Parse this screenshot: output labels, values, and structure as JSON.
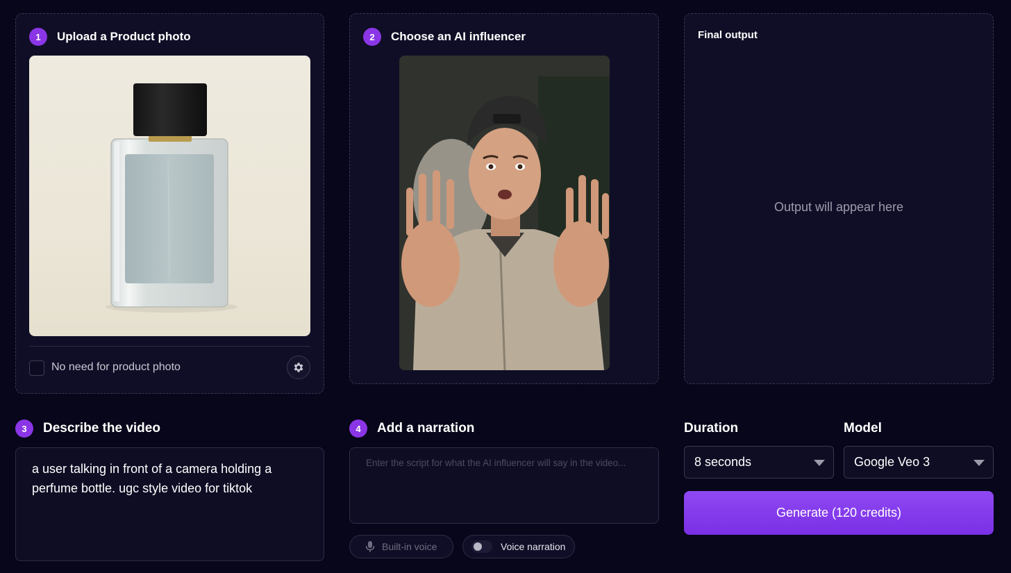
{
  "step1": {
    "number": "1",
    "title": "Upload a Product photo",
    "checkbox_label": "No need for product photo",
    "checked": false
  },
  "step2": {
    "number": "2",
    "title": "Choose an AI influencer"
  },
  "output": {
    "title": "Final output",
    "placeholder": "Output will appear here"
  },
  "step3": {
    "number": "3",
    "title": "Describe the video",
    "value": "a user talking in front of a camera holding a perfume bottle. ugc style video for tiktok"
  },
  "step4": {
    "number": "4",
    "title": "Add a narration",
    "placeholder": "Enter the script for what the AI influencer will say in the video...",
    "builtin_voice_label": "Built-in voice",
    "voice_narration_label": "Voice narration",
    "voice_narration_on": false
  },
  "duration": {
    "label": "Duration",
    "value": "8 seconds"
  },
  "model": {
    "label": "Model",
    "value": "Google Veo 3"
  },
  "generate": {
    "label": "Generate (120 credits)"
  },
  "colors": {
    "background": "#07061a",
    "card": "#100e26",
    "accent": "#8a36e6",
    "button": "#7a2fe6"
  },
  "icons": [
    "gear-icon",
    "microphone-icon",
    "toggle-switch",
    "chevron-down-icon"
  ]
}
